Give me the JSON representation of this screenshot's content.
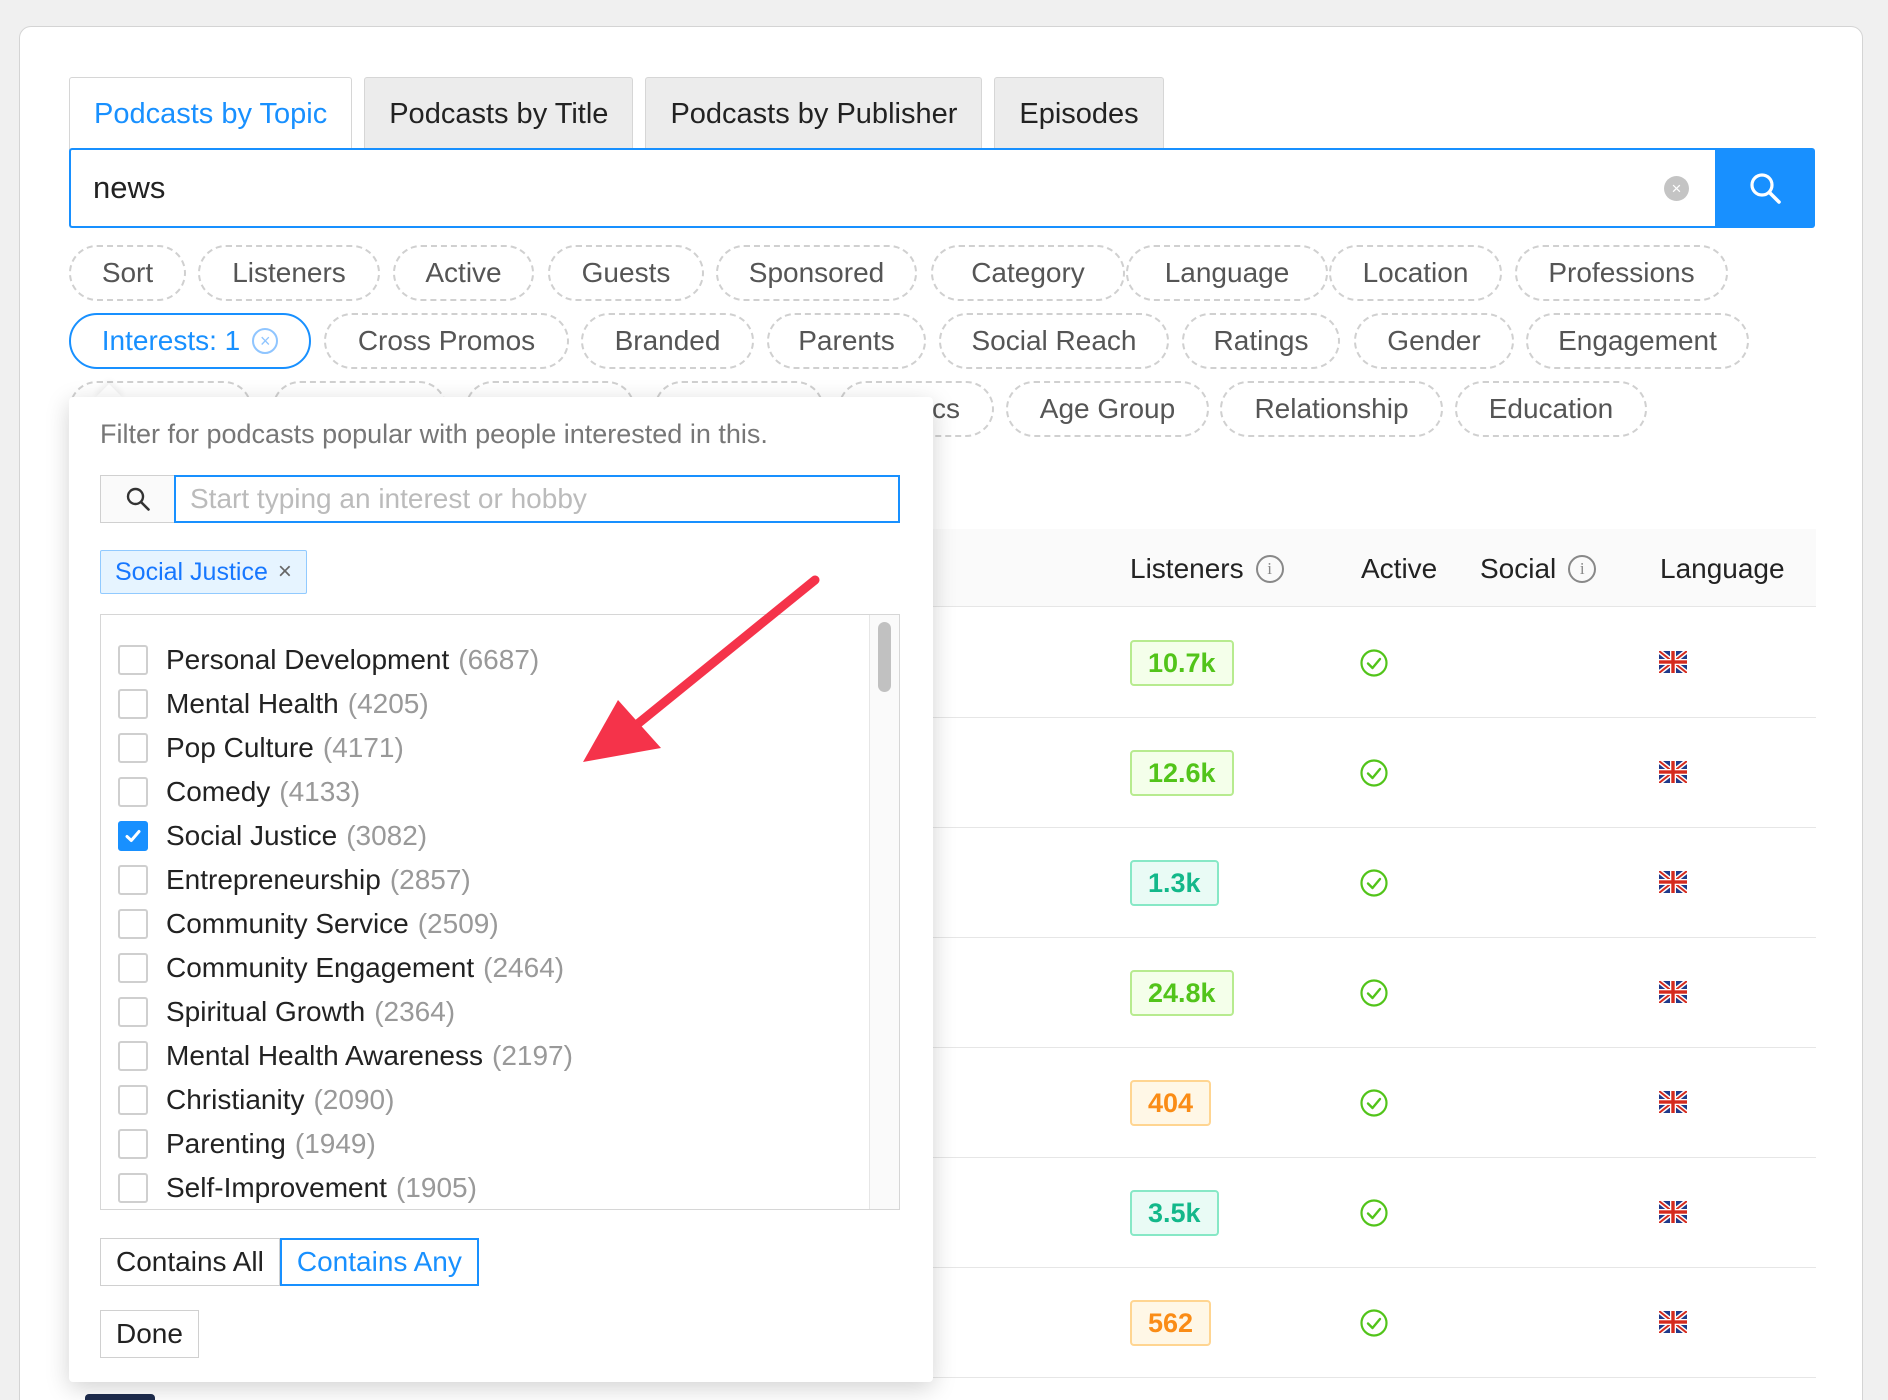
{
  "tabs": [
    {
      "label": "Podcasts by Topic",
      "active": true
    },
    {
      "label": "Podcasts by Title",
      "active": false
    },
    {
      "label": "Podcasts by Publisher",
      "active": false
    },
    {
      "label": "Episodes",
      "active": false
    }
  ],
  "search": {
    "value": "news",
    "clear_icon": "clear-circle-icon",
    "button_icon": "search-icon"
  },
  "filters": {
    "row1": [
      "Sort",
      "Listeners",
      "Active",
      "Guests",
      "Sponsored",
      "Category",
      "Language",
      "Location",
      "Professions"
    ],
    "interests_chip": "Interests: 1",
    "row2": [
      "Cross Promos",
      "Branded",
      "Parents",
      "Social Reach",
      "Ratings",
      "Gender",
      "Engagement"
    ],
    "row3_partial": "cs",
    "row3": [
      "Age Group",
      "Relationship",
      "Education"
    ]
  },
  "table": {
    "headers": {
      "listeners": "Listeners",
      "active": "Active",
      "social": "Social",
      "language": "Language"
    },
    "rows": [
      {
        "listeners": "10.7k",
        "tone": "green"
      },
      {
        "listeners": "12.6k",
        "tone": "green"
      },
      {
        "listeners": "1.3k",
        "tone": "teal"
      },
      {
        "listeners": "24.8k",
        "tone": "green"
      },
      {
        "listeners": "404",
        "tone": "orange"
      },
      {
        "listeners": "3.5k",
        "tone": "teal"
      },
      {
        "listeners": "562",
        "tone": "orange"
      }
    ],
    "colors": {
      "green": "#52c41a",
      "teal": "#13b88a",
      "orange": "#fa8c16"
    }
  },
  "popover": {
    "hint": "Filter for podcasts popular with people interested in this.",
    "search_placeholder": "Start typing an interest or hobby",
    "selected_tag": "Social Justice",
    "tag_close": "×",
    "options": [
      {
        "label": "Personal Development",
        "count": "(6687)",
        "checked": false
      },
      {
        "label": "Mental Health",
        "count": "(4205)",
        "checked": false
      },
      {
        "label": "Pop Culture",
        "count": "(4171)",
        "checked": false
      },
      {
        "label": "Comedy",
        "count": "(4133)",
        "checked": false
      },
      {
        "label": "Social Justice",
        "count": "(3082)",
        "checked": true
      },
      {
        "label": "Entrepreneurship",
        "count": "(2857)",
        "checked": false
      },
      {
        "label": "Community Service",
        "count": "(2509)",
        "checked": false
      },
      {
        "label": "Community Engagement",
        "count": "(2464)",
        "checked": false
      },
      {
        "label": "Spiritual Growth",
        "count": "(2364)",
        "checked": false
      },
      {
        "label": "Mental Health Awareness",
        "count": "(2197)",
        "checked": false
      },
      {
        "label": "Christianity",
        "count": "(2090)",
        "checked": false
      },
      {
        "label": "Parenting",
        "count": "(1949)",
        "checked": false
      },
      {
        "label": "Self-Improvement",
        "count": "(1905)",
        "checked": false
      }
    ],
    "match_modes": {
      "all": "Contains All",
      "any": "Contains Any",
      "selected": "any"
    },
    "done_label": "Done"
  },
  "accent_color": "#1890ff",
  "annotation_arrow_color": "#f5334a"
}
